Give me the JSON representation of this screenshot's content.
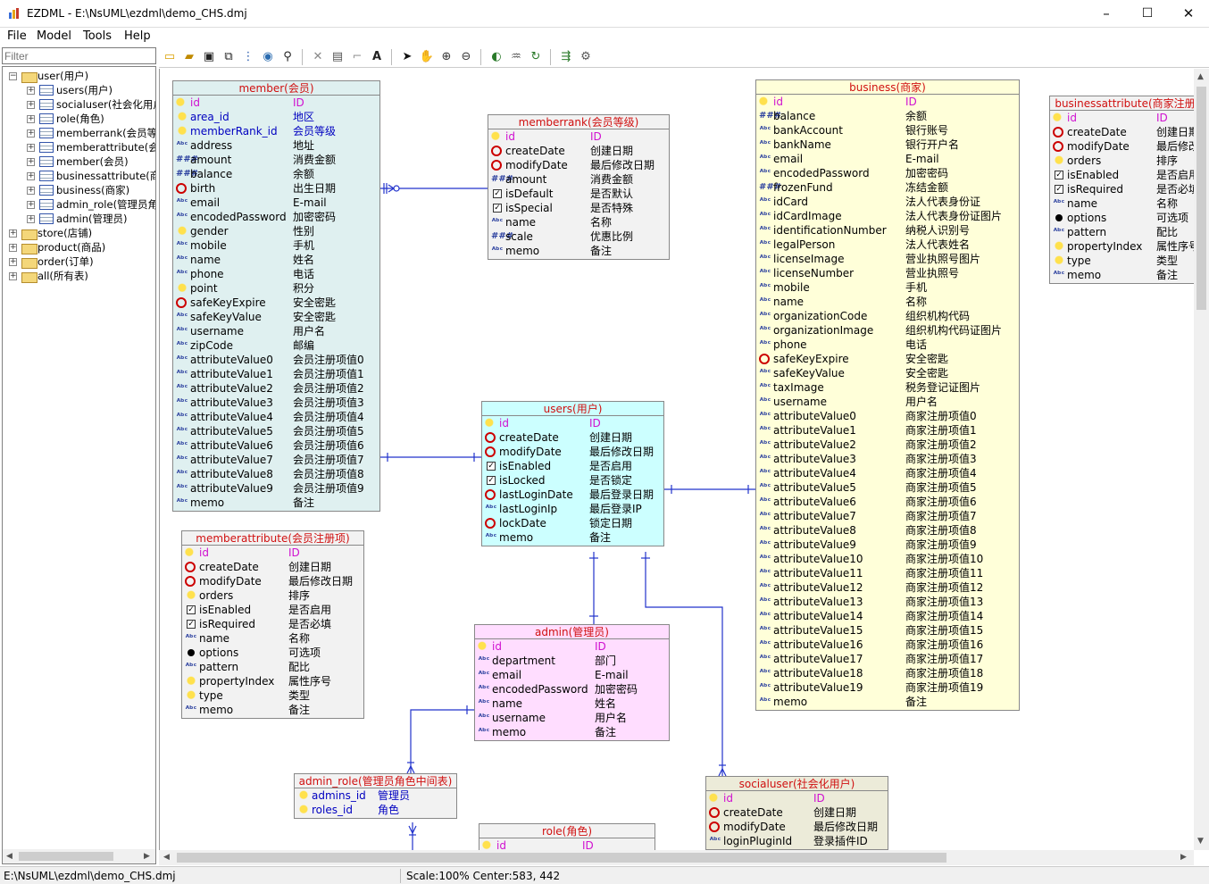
{
  "window": {
    "title": "EZDML - E:\\NsUML\\ezdml\\demo_CHS.dmj",
    "controls": [
      "–",
      "☐",
      "✕"
    ]
  },
  "menu": [
    "File",
    "Model",
    "Tools",
    "Help"
  ],
  "filter": {
    "placeholder": "Filter"
  },
  "tree": {
    "root": "user(用户)",
    "children": [
      "users(用户)",
      "socialuser(社会化用户)",
      "role(角色)",
      "memberrank(会员等级)",
      "memberattribute(会员",
      "member(会员)",
      "businessattribute(商家",
      "business(商家)",
      "admin_role(管理员角色",
      "admin(管理员)"
    ],
    "siblings": [
      "store(店铺)",
      "product(商品)",
      "order(订单)",
      "all(所有表)"
    ]
  },
  "status": {
    "path": "E:\\NsUML\\ezdml\\demo_CHS.dmj",
    "scale": "Scale:100% Center:583, 442"
  },
  "entities": [
    {
      "id": "member",
      "title": "member(会员)",
      "bg": "#dff0f0",
      "rows": [
        [
          "key",
          "id",
          "ID",
          "pk"
        ],
        [
          "bulb",
          "area_id",
          "地区",
          "fk"
        ],
        [
          "bulb",
          "memberRank_id",
          "会员等级",
          "fk"
        ],
        [
          "abc",
          "address",
          "地址",
          ""
        ],
        [
          "num",
          "amount",
          "消费金额",
          ""
        ],
        [
          "num",
          "balance",
          "余额",
          ""
        ],
        [
          "clk",
          "birth",
          "出生日期",
          ""
        ],
        [
          "abc",
          "email",
          "E-mail",
          ""
        ],
        [
          "abc",
          "encodedPassword",
          "加密密码",
          ""
        ],
        [
          "bulb",
          "gender",
          "性别",
          ""
        ],
        [
          "abc",
          "mobile",
          "手机",
          ""
        ],
        [
          "abc",
          "name",
          "姓名",
          ""
        ],
        [
          "abc",
          "phone",
          "电话",
          ""
        ],
        [
          "bulb",
          "point",
          "积分",
          ""
        ],
        [
          "clk",
          "safeKeyExpire",
          "安全密匙",
          ""
        ],
        [
          "abc",
          "safeKeyValue",
          "安全密匙",
          ""
        ],
        [
          "abc",
          "username",
          "用户名",
          ""
        ],
        [
          "abc",
          "zipCode",
          "邮编",
          ""
        ],
        [
          "abc",
          "attributeValue0",
          "会员注册项值0",
          ""
        ],
        [
          "abc",
          "attributeValue1",
          "会员注册项值1",
          ""
        ],
        [
          "abc",
          "attributeValue2",
          "会员注册项值2",
          ""
        ],
        [
          "abc",
          "attributeValue3",
          "会员注册项值3",
          ""
        ],
        [
          "abc",
          "attributeValue4",
          "会员注册项值4",
          ""
        ],
        [
          "abc",
          "attributeValue5",
          "会员注册项值5",
          ""
        ],
        [
          "abc",
          "attributeValue6",
          "会员注册项值6",
          ""
        ],
        [
          "abc",
          "attributeValue7",
          "会员注册项值7",
          ""
        ],
        [
          "abc",
          "attributeValue8",
          "会员注册项值8",
          ""
        ],
        [
          "abc",
          "attributeValue9",
          "会员注册项值9",
          ""
        ],
        [
          "abc",
          "memo",
          "备注",
          ""
        ]
      ]
    },
    {
      "id": "memberrank",
      "title": "memberrank(会员等级)",
      "bg": "#f2f2f2",
      "rows": [
        [
          "key",
          "id",
          "ID",
          "pk"
        ],
        [
          "clk",
          "createDate",
          "创建日期",
          ""
        ],
        [
          "clk",
          "modifyDate",
          "最后修改日期",
          ""
        ],
        [
          "num",
          "amount",
          "消费金额",
          ""
        ],
        [
          "chk",
          "isDefault",
          "是否默认",
          ""
        ],
        [
          "chk",
          "isSpecial",
          "是否特殊",
          ""
        ],
        [
          "abc",
          "name",
          "名称",
          ""
        ],
        [
          "num",
          "scale",
          "优惠比例",
          ""
        ],
        [
          "abc",
          "memo",
          "备注",
          ""
        ]
      ]
    },
    {
      "id": "business",
      "title": "business(商家)",
      "bg": "#ffffd9",
      "rows": [
        [
          "key",
          "id",
          "ID",
          "pk"
        ],
        [
          "num",
          "balance",
          "余额",
          ""
        ],
        [
          "abc",
          "bankAccount",
          "银行账号",
          ""
        ],
        [
          "abc",
          "bankName",
          "银行开户名",
          ""
        ],
        [
          "abc",
          "email",
          "E-mail",
          ""
        ],
        [
          "abc",
          "encodedPassword",
          "加密密码",
          ""
        ],
        [
          "num",
          "frozenFund",
          "冻结金额",
          ""
        ],
        [
          "abc",
          "idCard",
          "法人代表身份证",
          ""
        ],
        [
          "abc",
          "idCardImage",
          "法人代表身份证图片",
          ""
        ],
        [
          "abc",
          "identificationNumber",
          "纳税人识别号",
          ""
        ],
        [
          "abc",
          "legalPerson",
          "法人代表姓名",
          ""
        ],
        [
          "abc",
          "licenseImage",
          "营业执照号图片",
          ""
        ],
        [
          "abc",
          "licenseNumber",
          "营业执照号",
          ""
        ],
        [
          "abc",
          "mobile",
          "手机",
          ""
        ],
        [
          "abc",
          "name",
          "名称",
          ""
        ],
        [
          "abc",
          "organizationCode",
          "组织机构代码",
          ""
        ],
        [
          "abc",
          "organizationImage",
          "组织机构代码证图片",
          ""
        ],
        [
          "abc",
          "phone",
          "电话",
          ""
        ],
        [
          "clk",
          "safeKeyExpire",
          "安全密匙",
          ""
        ],
        [
          "abc",
          "safeKeyValue",
          "安全密匙",
          ""
        ],
        [
          "abc",
          "taxImage",
          "税务登记证图片",
          ""
        ],
        [
          "abc",
          "username",
          "用户名",
          ""
        ],
        [
          "abc",
          "attributeValue0",
          "商家注册项值0",
          ""
        ],
        [
          "abc",
          "attributeValue1",
          "商家注册项值1",
          ""
        ],
        [
          "abc",
          "attributeValue2",
          "商家注册项值2",
          ""
        ],
        [
          "abc",
          "attributeValue3",
          "商家注册项值3",
          ""
        ],
        [
          "abc",
          "attributeValue4",
          "商家注册项值4",
          ""
        ],
        [
          "abc",
          "attributeValue5",
          "商家注册项值5",
          ""
        ],
        [
          "abc",
          "attributeValue6",
          "商家注册项值6",
          ""
        ],
        [
          "abc",
          "attributeValue7",
          "商家注册项值7",
          ""
        ],
        [
          "abc",
          "attributeValue8",
          "商家注册项值8",
          ""
        ],
        [
          "abc",
          "attributeValue9",
          "商家注册项值9",
          ""
        ],
        [
          "abc",
          "attributeValue10",
          "商家注册项值10",
          ""
        ],
        [
          "abc",
          "attributeValue11",
          "商家注册项值11",
          ""
        ],
        [
          "abc",
          "attributeValue12",
          "商家注册项值12",
          ""
        ],
        [
          "abc",
          "attributeValue13",
          "商家注册项值13",
          ""
        ],
        [
          "abc",
          "attributeValue14",
          "商家注册项值14",
          ""
        ],
        [
          "abc",
          "attributeValue15",
          "商家注册项值15",
          ""
        ],
        [
          "abc",
          "attributeValue16",
          "商家注册项值16",
          ""
        ],
        [
          "abc",
          "attributeValue17",
          "商家注册项值17",
          ""
        ],
        [
          "abc",
          "attributeValue18",
          "商家注册项值18",
          ""
        ],
        [
          "abc",
          "attributeValue19",
          "商家注册项值19",
          ""
        ],
        [
          "abc",
          "memo",
          "备注",
          ""
        ]
      ]
    },
    {
      "id": "businessattribute",
      "title": "businessattribute(商家注册",
      "bg": "#f2f2f2",
      "rows": [
        [
          "key",
          "id",
          "ID",
          "pk"
        ],
        [
          "clk",
          "createDate",
          "创建日期",
          ""
        ],
        [
          "clk",
          "modifyDate",
          "最后修改",
          ""
        ],
        [
          "bulb",
          "orders",
          "排序",
          ""
        ],
        [
          "chk",
          "isEnabled",
          "是否启用",
          ""
        ],
        [
          "chk",
          "isRequired",
          "是否必填",
          ""
        ],
        [
          "abc",
          "name",
          "名称",
          ""
        ],
        [
          "dot",
          "options",
          "可选项",
          ""
        ],
        [
          "abc",
          "pattern",
          "配比",
          ""
        ],
        [
          "bulb",
          "propertyIndex",
          "属性序号",
          ""
        ],
        [
          "bulb",
          "type",
          "类型",
          ""
        ],
        [
          "abc",
          "memo",
          "备注",
          ""
        ]
      ]
    },
    {
      "id": "users",
      "title": "users(用户)",
      "bg": "#ccffff",
      "rows": [
        [
          "key",
          "id",
          "ID",
          "pk"
        ],
        [
          "clk",
          "createDate",
          "创建日期",
          ""
        ],
        [
          "clk",
          "modifyDate",
          "最后修改日期",
          ""
        ],
        [
          "chk",
          "isEnabled",
          "是否启用",
          ""
        ],
        [
          "chk",
          "isLocked",
          "是否锁定",
          ""
        ],
        [
          "clk",
          "lastLoginDate",
          "最后登录日期",
          ""
        ],
        [
          "abc",
          "lastLoginIp",
          "最后登录IP",
          ""
        ],
        [
          "clk",
          "lockDate",
          "锁定日期",
          ""
        ],
        [
          "abc",
          "memo",
          "备注",
          ""
        ]
      ]
    },
    {
      "id": "memberattribute",
      "title": "memberattribute(会员注册项)",
      "bg": "#f2f2f2",
      "rows": [
        [
          "key",
          "id",
          "ID",
          "pk"
        ],
        [
          "clk",
          "createDate",
          "创建日期",
          ""
        ],
        [
          "clk",
          "modifyDate",
          "最后修改日期",
          ""
        ],
        [
          "bulb",
          "orders",
          "排序",
          ""
        ],
        [
          "chk",
          "isEnabled",
          "是否启用",
          ""
        ],
        [
          "chk",
          "isRequired",
          "是否必填",
          ""
        ],
        [
          "abc",
          "name",
          "名称",
          ""
        ],
        [
          "dot",
          "options",
          "可选项",
          ""
        ],
        [
          "abc",
          "pattern",
          "配比",
          ""
        ],
        [
          "bulb",
          "propertyIndex",
          "属性序号",
          ""
        ],
        [
          "bulb",
          "type",
          "类型",
          ""
        ],
        [
          "abc",
          "memo",
          "备注",
          ""
        ]
      ]
    },
    {
      "id": "admin",
      "title": "admin(管理员)",
      "bg": "#ffddff",
      "rows": [
        [
          "key",
          "id",
          "ID",
          "pk"
        ],
        [
          "abc",
          "department",
          "部门",
          ""
        ],
        [
          "abc",
          "email",
          "E-mail",
          ""
        ],
        [
          "abc",
          "encodedPassword",
          "加密密码",
          ""
        ],
        [
          "abc",
          "name",
          "姓名",
          ""
        ],
        [
          "abc",
          "username",
          "用户名",
          ""
        ],
        [
          "abc",
          "memo",
          "备注",
          ""
        ]
      ]
    },
    {
      "id": "admin_role",
      "title": "admin_role(管理员角色中间表)",
      "bg": "#f2f2f2",
      "rows": [
        [
          "bulb",
          "admins_id",
          "管理员",
          "fk"
        ],
        [
          "bulb",
          "roles_id",
          "角色",
          "fk"
        ]
      ]
    },
    {
      "id": "role",
      "title": "role(角色)",
      "bg": "#f2f2f2",
      "rows": [
        [
          "key",
          "id",
          "ID",
          "pk"
        ]
      ]
    },
    {
      "id": "socialuser",
      "title": "socialuser(社会化用户)",
      "bg": "#ecebd9",
      "rows": [
        [
          "key",
          "id",
          "ID",
          "pk"
        ],
        [
          "clk",
          "createDate",
          "创建日期",
          ""
        ],
        [
          "clk",
          "modifyDate",
          "最后修改日期",
          ""
        ],
        [
          "abc",
          "loginPluginId",
          "登录插件ID",
          ""
        ]
      ]
    }
  ]
}
